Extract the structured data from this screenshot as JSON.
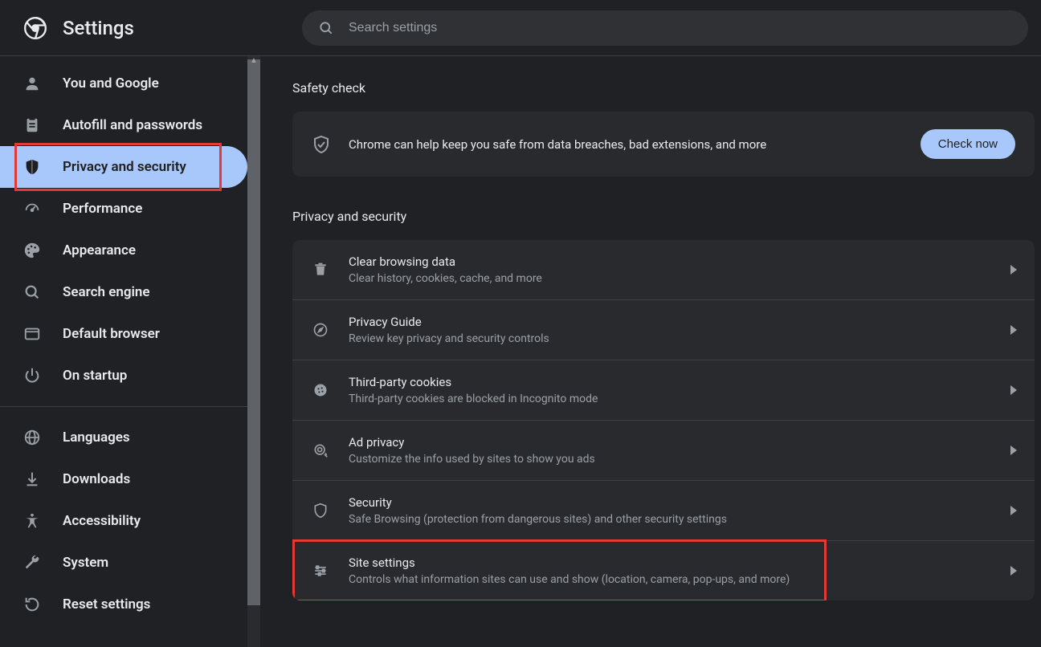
{
  "header": {
    "title": "Settings",
    "search_placeholder": "Search settings"
  },
  "sidebar": {
    "items": [
      {
        "label": "You and Google",
        "icon": "person-icon"
      },
      {
        "label": "Autofill and passwords",
        "icon": "clipboard-icon"
      },
      {
        "label": "Privacy and security",
        "icon": "shield-icon",
        "selected": true
      },
      {
        "label": "Performance",
        "icon": "speedometer-icon"
      },
      {
        "label": "Appearance",
        "icon": "palette-icon"
      },
      {
        "label": "Search engine",
        "icon": "search-icon"
      },
      {
        "label": "Default browser",
        "icon": "browser-icon"
      },
      {
        "label": "On startup",
        "icon": "power-icon"
      }
    ],
    "items2": [
      {
        "label": "Languages",
        "icon": "globe-icon"
      },
      {
        "label": "Downloads",
        "icon": "download-icon"
      },
      {
        "label": "Accessibility",
        "icon": "accessibility-icon"
      },
      {
        "label": "System",
        "icon": "wrench-icon"
      },
      {
        "label": "Reset settings",
        "icon": "reset-icon"
      }
    ]
  },
  "safety": {
    "section_title": "Safety check",
    "text": "Chrome can help keep you safe from data breaches, bad extensions, and more",
    "button": "Check now"
  },
  "privacy": {
    "section_title": "Privacy and security",
    "rows": [
      {
        "title": "Clear browsing data",
        "sub": "Clear history, cookies, cache, and more",
        "icon": "trash-icon"
      },
      {
        "title": "Privacy Guide",
        "sub": "Review key privacy and security controls",
        "icon": "compass-icon"
      },
      {
        "title": "Third-party cookies",
        "sub": "Third-party cookies are blocked in Incognito mode",
        "icon": "cookie-icon"
      },
      {
        "title": "Ad privacy",
        "sub": "Customize the info used by sites to show you ads",
        "icon": "ad-target-icon"
      },
      {
        "title": "Security",
        "sub": "Safe Browsing (protection from dangerous sites) and other security settings",
        "icon": "shield-outline-icon"
      },
      {
        "title": "Site settings",
        "sub": "Controls what information sites can use and show (location, camera, pop-ups, and more)",
        "icon": "sliders-icon"
      }
    ]
  },
  "highlights": {
    "sidebar_privacy": true,
    "site_settings": true
  }
}
